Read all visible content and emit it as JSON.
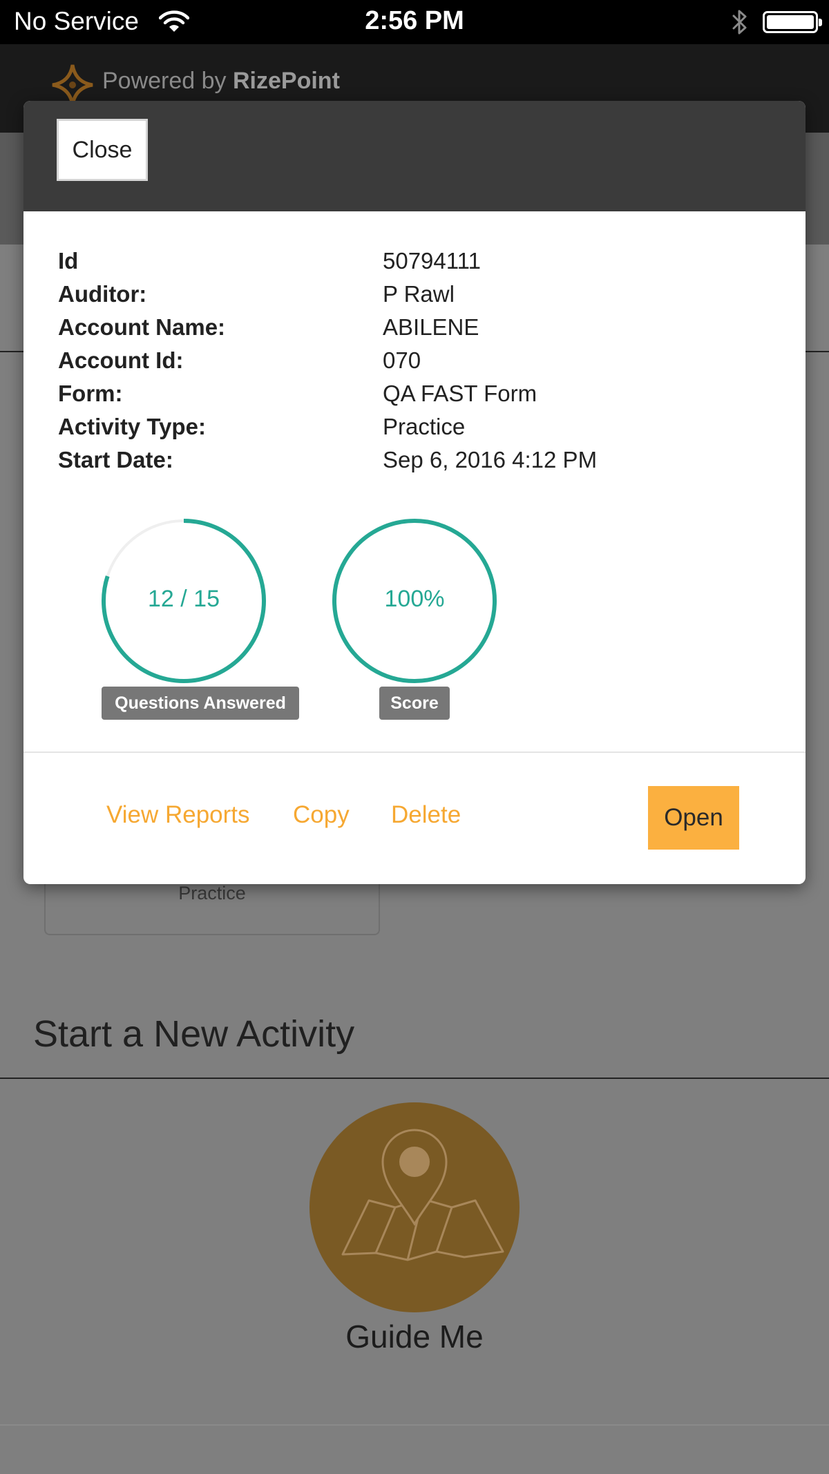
{
  "status_bar": {
    "carrier": "No Service",
    "time": "2:56 PM"
  },
  "header": {
    "brand_prefix": "Powered by",
    "brand_name": "RizePoint"
  },
  "background": {
    "card_label": "Practice",
    "section_title": "Start a New Activity",
    "guide_label": "Guide Me",
    "guide_color": "#f6a832"
  },
  "modal": {
    "close_label": "Close",
    "details": [
      {
        "label": "Id",
        "value": "50794111"
      },
      {
        "label": "Auditor:",
        "value": "P Rawl"
      },
      {
        "label": "Account Name:",
        "value": "ABILENE"
      },
      {
        "label": "Account Id:",
        "value": "070"
      },
      {
        "label": "Form:",
        "value": "QA FAST Form"
      },
      {
        "label": "Activity Type:",
        "value": "Practice"
      },
      {
        "label": "Start Date:",
        "value": "Sep 6, 2016 4:12 PM"
      }
    ],
    "progress": {
      "answered": 12,
      "total": 15,
      "text": "12 / 15",
      "label": "Questions Answered"
    },
    "score": {
      "percent": 100,
      "text": "100%",
      "label": "Score"
    },
    "actions": {
      "view_reports": "View Reports",
      "copy": "Copy",
      "delete": "Delete",
      "open": "Open"
    },
    "accent_color": "#f6a832",
    "ring_color": "#25a894"
  }
}
